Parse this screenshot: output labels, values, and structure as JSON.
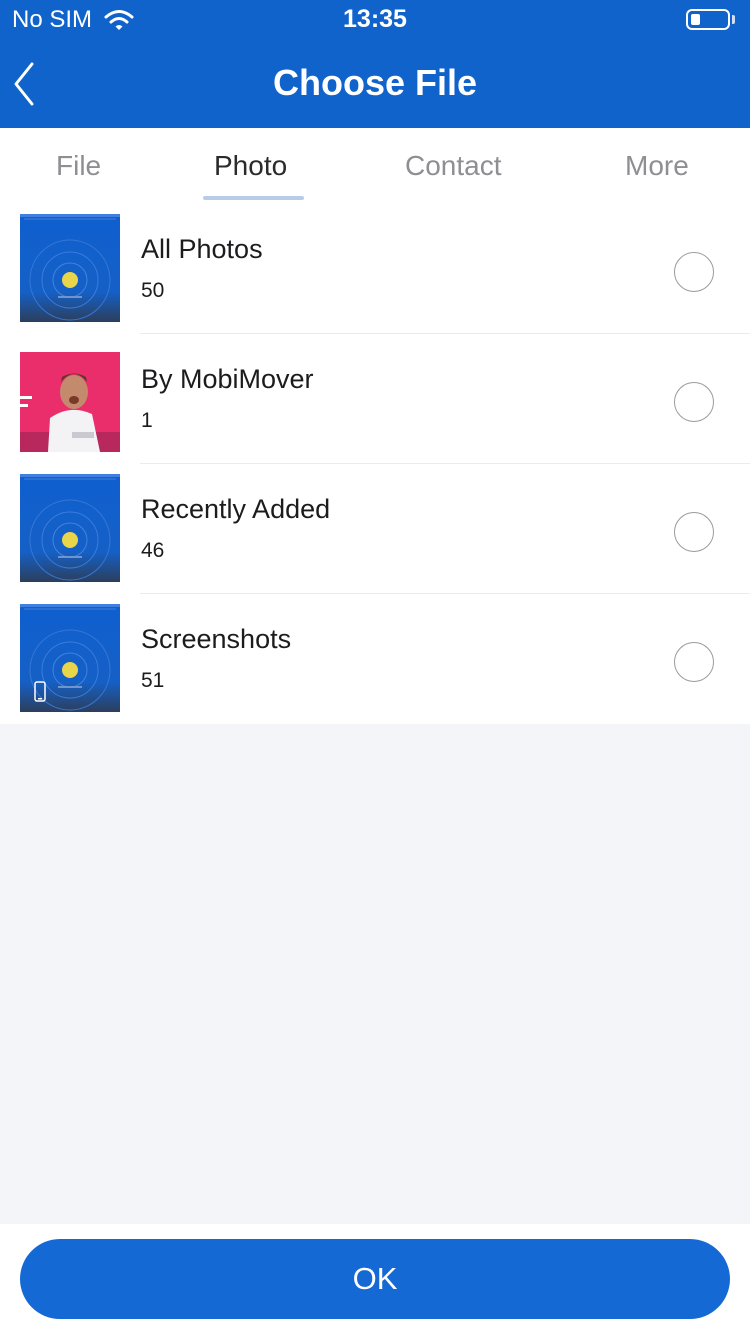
{
  "status_bar": {
    "carrier": "No SIM",
    "time": "13:35",
    "battery_level": 0.25
  },
  "nav": {
    "title": "Choose File",
    "back_icon": "chevron-left-icon"
  },
  "tabs": [
    {
      "label": "File",
      "active": false
    },
    {
      "label": "Photo",
      "active": true
    },
    {
      "label": "Contact",
      "active": false
    },
    {
      "label": "More",
      "active": false
    }
  ],
  "albums": [
    {
      "name": "All Photos",
      "count": "50",
      "thumbnail": "blue-screen-thumbnail",
      "selected": false
    },
    {
      "name": "By MobiMover",
      "count": "1",
      "thumbnail": "pink-photo-thumbnail",
      "selected": false
    },
    {
      "name": "Recently Added",
      "count": "46",
      "thumbnail": "blue-screen-thumbnail",
      "selected": false
    },
    {
      "name": "Screenshots",
      "count": "51",
      "thumbnail": "blue-screen-phone-thumbnail",
      "selected": false
    }
  ],
  "footer": {
    "ok_label": "OK"
  },
  "colors": {
    "header_bg": "#1163cc",
    "button_bg": "#1469d5",
    "page_bg": "#f4f5f8"
  }
}
